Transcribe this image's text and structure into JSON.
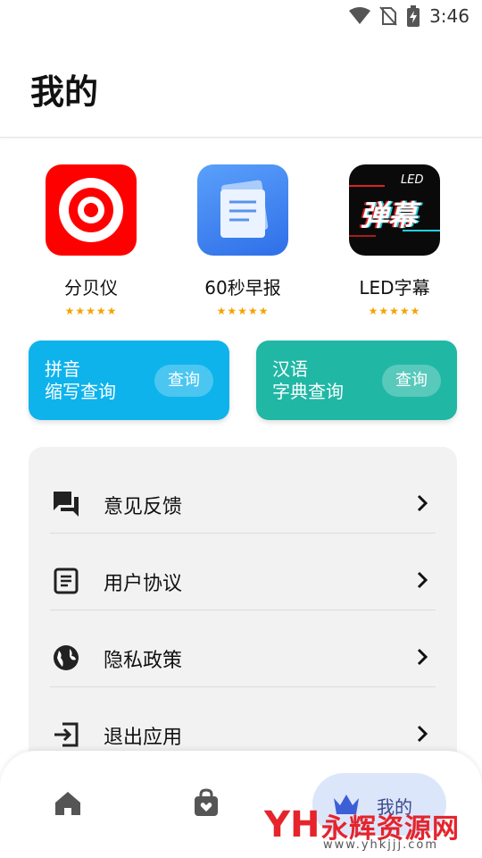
{
  "status_bar": {
    "time": "3:46"
  },
  "header": {
    "title": "我的"
  },
  "apps": [
    {
      "name": "分贝仪",
      "stars": "★★★★★",
      "icon": "target-icon"
    },
    {
      "name": "60秒早报",
      "stars": "★★★★★",
      "icon": "document-icon"
    },
    {
      "name": "LED字幕",
      "stars": "★★★★★",
      "icon": "led-danmu-icon",
      "icon_text_top": "LED",
      "icon_text_main": "弹幕"
    }
  ],
  "query_cards": [
    {
      "line1": "拼音",
      "line2": "缩写查询",
      "button": "查询",
      "color": "#0eb3ec"
    },
    {
      "line1": "汉语",
      "line2": "字典查询",
      "button": "查询",
      "color": "#20b7a5"
    }
  ],
  "menu": [
    {
      "label": "意见反馈",
      "icon": "feedback-icon"
    },
    {
      "label": "用户协议",
      "icon": "document-list-icon"
    },
    {
      "label": "隐私政策",
      "icon": "globe-icon"
    },
    {
      "label": "退出应用",
      "icon": "exit-icon"
    }
  ],
  "tab_bar": {
    "tabs": [
      {
        "icon": "home-icon"
      },
      {
        "icon": "shopping-bag-icon"
      },
      {
        "icon": "crown-icon",
        "label": "我的",
        "active": true
      }
    ]
  },
  "watermark": {
    "logo_text": "YH",
    "brand": "永辉资源网",
    "url": "www.yhkjjj.com"
  },
  "colors": {
    "accent_red": "#ff0000",
    "accent_blue": "#3d7ff0",
    "active_tab_bg": "#dce6fb"
  }
}
